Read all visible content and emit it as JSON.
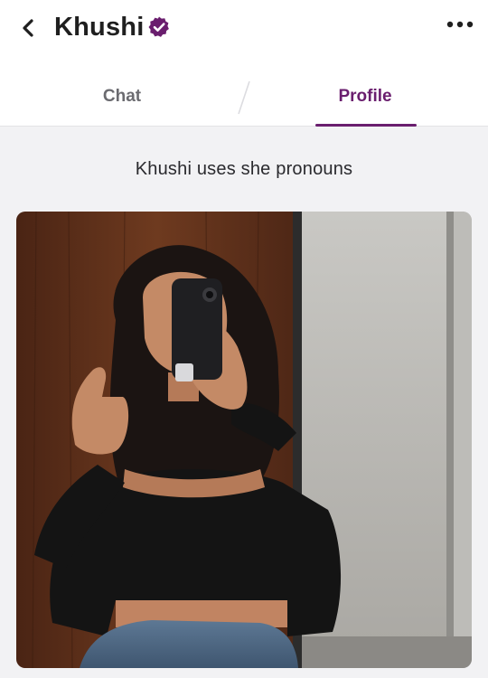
{
  "header": {
    "title": "Khushi",
    "back_icon": "chevron-left-icon",
    "verified_icon": "verified-badge-icon",
    "more_icon": "more-horizontal-icon"
  },
  "tabs": [
    {
      "label": "Chat",
      "active": false
    },
    {
      "label": "Profile",
      "active": true
    }
  ],
  "profile": {
    "pronouns_text": "Khushi uses she pronouns"
  },
  "colors": {
    "accent": "#6a1e6e",
    "background": "#f2f2f4",
    "header_bg": "#ffffff",
    "inactive_tab": "#6b6b70"
  }
}
